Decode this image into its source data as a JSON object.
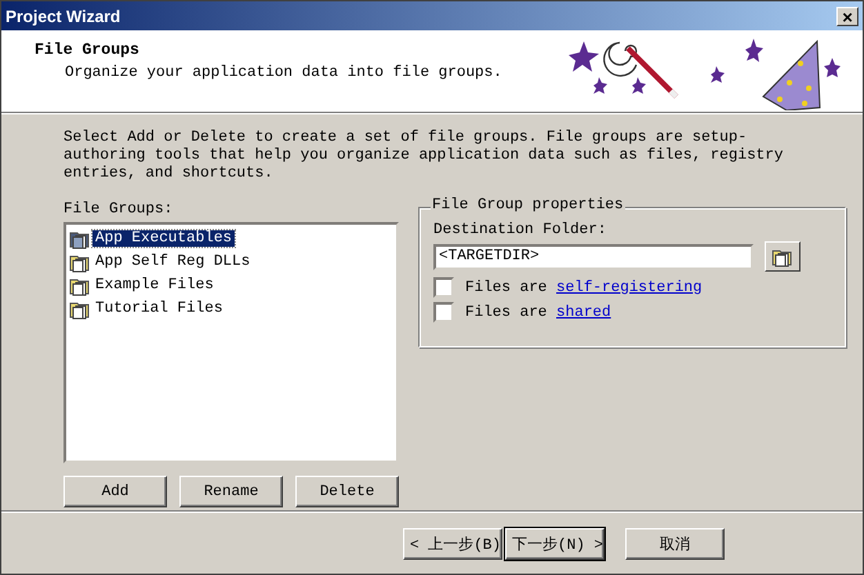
{
  "window": {
    "title": "Project Wizard",
    "close": "×"
  },
  "header": {
    "title": "File Groups",
    "subtitle": "Organize your application data into file groups."
  },
  "instructions": "Select Add or Delete to create a set of file groups.  File groups are setup-authoring tools that help you organize application data such as files, registry entries, and shortcuts.",
  "file_groups": {
    "label": "File Groups:",
    "items": [
      {
        "label": "App Executables",
        "selected": true
      },
      {
        "label": "App Self Reg DLLs",
        "selected": false
      },
      {
        "label": "Example Files",
        "selected": false
      },
      {
        "label": "Tutorial Files",
        "selected": false
      }
    ],
    "buttons": [
      "Add",
      "Rename",
      "Delete"
    ]
  },
  "properties": {
    "title": "File Group properties",
    "destination_label": "Destination Folder:",
    "destination_value": "<TARGETDIR>",
    "options": [
      {
        "text": "Files are",
        "link": "self-registering",
        "checked": false
      },
      {
        "text": "Files are",
        "link": "shared",
        "checked": false
      }
    ]
  },
  "nav_buttons": [
    {
      "label": "< 上一步(B)",
      "default": false
    },
    {
      "label": "下一步(N) >",
      "default": true
    },
    {
      "label": "取消",
      "default": false
    }
  ]
}
